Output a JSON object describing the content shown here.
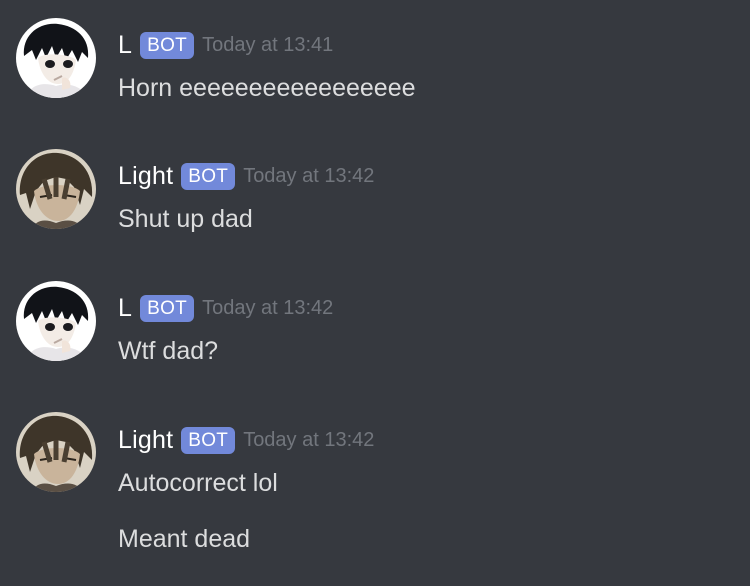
{
  "messages": [
    {
      "username": "L",
      "tag": "BOT",
      "timestamp": "Today at 13:41",
      "lines": [
        "Horn eeeeeeeeeeeeeeeee"
      ]
    },
    {
      "username": "Light",
      "tag": "BOT",
      "timestamp": "Today at 13:42",
      "lines": [
        "Shut up dad"
      ]
    },
    {
      "username": "L",
      "tag": "BOT",
      "timestamp": "Today at 13:42",
      "lines": [
        "Wtf dad?"
      ]
    },
    {
      "username": "Light",
      "tag": "BOT",
      "timestamp": "Today at 13:42",
      "lines": [
        "Autocorrect lol",
        "Meant dead"
      ]
    }
  ],
  "colors": {
    "background": "#36393f",
    "username": "#ffffff",
    "bot_tag": "#7289da",
    "timestamp": "#72767d",
    "message_text": "#dcddde"
  },
  "icons": {
    "avatar_l": "avatar-l-icon",
    "avatar_light": "avatar-light-icon"
  }
}
